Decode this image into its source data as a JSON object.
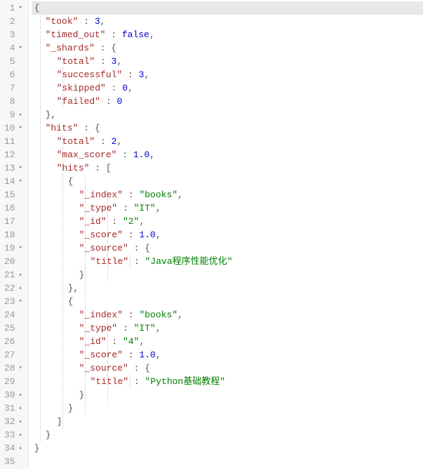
{
  "lines": [
    {
      "n": 1,
      "fold": "▾",
      "active": true,
      "guides": [],
      "indent": 0,
      "tokens": [
        {
          "t": "punc",
          "v": "{"
        }
      ]
    },
    {
      "n": 2,
      "fold": "",
      "active": false,
      "guides": [
        1
      ],
      "indent": 1,
      "tokens": [
        {
          "t": "key",
          "v": "\"took\""
        },
        {
          "t": "punc",
          "v": " : "
        },
        {
          "t": "num",
          "v": "3"
        },
        {
          "t": "punc",
          "v": ","
        }
      ]
    },
    {
      "n": 3,
      "fold": "",
      "active": false,
      "guides": [
        1
      ],
      "indent": 1,
      "tokens": [
        {
          "t": "key",
          "v": "\"timed_out\""
        },
        {
          "t": "punc",
          "v": " : "
        },
        {
          "t": "bool",
          "v": "false"
        },
        {
          "t": "punc",
          "v": ","
        }
      ]
    },
    {
      "n": 4,
      "fold": "▾",
      "active": false,
      "guides": [
        1
      ],
      "indent": 1,
      "tokens": [
        {
          "t": "key",
          "v": "\"_shards\""
        },
        {
          "t": "punc",
          "v": " : {"
        }
      ]
    },
    {
      "n": 5,
      "fold": "",
      "active": false,
      "guides": [
        1,
        2
      ],
      "indent": 2,
      "tokens": [
        {
          "t": "key",
          "v": "\"total\""
        },
        {
          "t": "punc",
          "v": " : "
        },
        {
          "t": "num",
          "v": "3"
        },
        {
          "t": "punc",
          "v": ","
        }
      ]
    },
    {
      "n": 6,
      "fold": "",
      "active": false,
      "guides": [
        1,
        2
      ],
      "indent": 2,
      "tokens": [
        {
          "t": "key",
          "v": "\"successful\""
        },
        {
          "t": "punc",
          "v": " : "
        },
        {
          "t": "num",
          "v": "3"
        },
        {
          "t": "punc",
          "v": ","
        }
      ]
    },
    {
      "n": 7,
      "fold": "",
      "active": false,
      "guides": [
        1,
        2
      ],
      "indent": 2,
      "tokens": [
        {
          "t": "key",
          "v": "\"skipped\""
        },
        {
          "t": "punc",
          "v": " : "
        },
        {
          "t": "num",
          "v": "0"
        },
        {
          "t": "punc",
          "v": ","
        }
      ]
    },
    {
      "n": 8,
      "fold": "",
      "active": false,
      "guides": [
        1,
        2
      ],
      "indent": 2,
      "tokens": [
        {
          "t": "key",
          "v": "\"failed\""
        },
        {
          "t": "punc",
          "v": " : "
        },
        {
          "t": "num",
          "v": "0"
        }
      ]
    },
    {
      "n": 9,
      "fold": "▴",
      "active": false,
      "guides": [
        1
      ],
      "indent": 1,
      "tokens": [
        {
          "t": "punc",
          "v": "},"
        }
      ]
    },
    {
      "n": 10,
      "fold": "▾",
      "active": false,
      "guides": [
        1
      ],
      "indent": 1,
      "tokens": [
        {
          "t": "key",
          "v": "\"hits\""
        },
        {
          "t": "punc",
          "v": " : {"
        }
      ]
    },
    {
      "n": 11,
      "fold": "",
      "active": false,
      "guides": [
        1,
        2
      ],
      "indent": 2,
      "tokens": [
        {
          "t": "key",
          "v": "\"total\""
        },
        {
          "t": "punc",
          "v": " : "
        },
        {
          "t": "num",
          "v": "2"
        },
        {
          "t": "punc",
          "v": ","
        }
      ]
    },
    {
      "n": 12,
      "fold": "",
      "active": false,
      "guides": [
        1,
        2
      ],
      "indent": 2,
      "tokens": [
        {
          "t": "key",
          "v": "\"max_score\""
        },
        {
          "t": "punc",
          "v": " : "
        },
        {
          "t": "num",
          "v": "1.0"
        },
        {
          "t": "punc",
          "v": ","
        }
      ]
    },
    {
      "n": 13,
      "fold": "▾",
      "active": false,
      "guides": [
        1,
        2
      ],
      "indent": 2,
      "tokens": [
        {
          "t": "key",
          "v": "\"hits\""
        },
        {
          "t": "punc",
          "v": " : ["
        }
      ]
    },
    {
      "n": 14,
      "fold": "▾",
      "active": false,
      "guides": [
        1,
        2,
        3
      ],
      "indent": 3,
      "tokens": [
        {
          "t": "punc",
          "v": "{"
        }
      ]
    },
    {
      "n": 15,
      "fold": "",
      "active": false,
      "guides": [
        1,
        2,
        3,
        4
      ],
      "indent": 4,
      "tokens": [
        {
          "t": "key",
          "v": "\"_index\""
        },
        {
          "t": "punc",
          "v": " : "
        },
        {
          "t": "str",
          "v": "\"books\""
        },
        {
          "t": "punc",
          "v": ","
        }
      ]
    },
    {
      "n": 16,
      "fold": "",
      "active": false,
      "guides": [
        1,
        2,
        3,
        4
      ],
      "indent": 4,
      "tokens": [
        {
          "t": "key",
          "v": "\"_type\""
        },
        {
          "t": "punc",
          "v": " : "
        },
        {
          "t": "str",
          "v": "\"IT\""
        },
        {
          "t": "punc",
          "v": ","
        }
      ]
    },
    {
      "n": 17,
      "fold": "",
      "active": false,
      "guides": [
        1,
        2,
        3,
        4
      ],
      "indent": 4,
      "tokens": [
        {
          "t": "key",
          "v": "\"_id\""
        },
        {
          "t": "punc",
          "v": " : "
        },
        {
          "t": "str",
          "v": "\"2\""
        },
        {
          "t": "punc",
          "v": ","
        }
      ]
    },
    {
      "n": 18,
      "fold": "",
      "active": false,
      "guides": [
        1,
        2,
        3,
        4
      ],
      "indent": 4,
      "tokens": [
        {
          "t": "key",
          "v": "\"_score\""
        },
        {
          "t": "punc",
          "v": " : "
        },
        {
          "t": "num",
          "v": "1.0"
        },
        {
          "t": "punc",
          "v": ","
        }
      ]
    },
    {
      "n": 19,
      "fold": "▾",
      "active": false,
      "guides": [
        1,
        2,
        3,
        4
      ],
      "indent": 4,
      "tokens": [
        {
          "t": "key",
          "v": "\"_source\""
        },
        {
          "t": "punc",
          "v": " : {"
        }
      ]
    },
    {
      "n": 20,
      "fold": "",
      "active": false,
      "guides": [
        1,
        2,
        3,
        4,
        5
      ],
      "indent": 5,
      "tokens": [
        {
          "t": "key",
          "v": "\"title\""
        },
        {
          "t": "punc",
          "v": " : "
        },
        {
          "t": "str",
          "v": "\"Java程序性能优化\""
        }
      ]
    },
    {
      "n": 21,
      "fold": "▴",
      "active": false,
      "guides": [
        1,
        2,
        3,
        4
      ],
      "indent": 4,
      "tokens": [
        {
          "t": "punc",
          "v": "}"
        }
      ]
    },
    {
      "n": 22,
      "fold": "▴",
      "active": false,
      "guides": [
        1,
        2,
        3
      ],
      "indent": 3,
      "tokens": [
        {
          "t": "punc",
          "v": "},"
        }
      ]
    },
    {
      "n": 23,
      "fold": "▾",
      "active": false,
      "guides": [
        1,
        2,
        3
      ],
      "indent": 3,
      "tokens": [
        {
          "t": "punc",
          "v": "{"
        }
      ]
    },
    {
      "n": 24,
      "fold": "",
      "active": false,
      "guides": [
        1,
        2,
        3,
        4
      ],
      "indent": 4,
      "tokens": [
        {
          "t": "key",
          "v": "\"_index\""
        },
        {
          "t": "punc",
          "v": " : "
        },
        {
          "t": "str",
          "v": "\"books\""
        },
        {
          "t": "punc",
          "v": ","
        }
      ]
    },
    {
      "n": 25,
      "fold": "",
      "active": false,
      "guides": [
        1,
        2,
        3,
        4
      ],
      "indent": 4,
      "tokens": [
        {
          "t": "key",
          "v": "\"_type\""
        },
        {
          "t": "punc",
          "v": " : "
        },
        {
          "t": "str",
          "v": "\"IT\""
        },
        {
          "t": "punc",
          "v": ","
        }
      ]
    },
    {
      "n": 26,
      "fold": "",
      "active": false,
      "guides": [
        1,
        2,
        3,
        4
      ],
      "indent": 4,
      "tokens": [
        {
          "t": "key",
          "v": "\"_id\""
        },
        {
          "t": "punc",
          "v": " : "
        },
        {
          "t": "str",
          "v": "\"4\""
        },
        {
          "t": "punc",
          "v": ","
        }
      ]
    },
    {
      "n": 27,
      "fold": "",
      "active": false,
      "guides": [
        1,
        2,
        3,
        4
      ],
      "indent": 4,
      "tokens": [
        {
          "t": "key",
          "v": "\"_score\""
        },
        {
          "t": "punc",
          "v": " : "
        },
        {
          "t": "num",
          "v": "1.0"
        },
        {
          "t": "punc",
          "v": ","
        }
      ]
    },
    {
      "n": 28,
      "fold": "▾",
      "active": false,
      "guides": [
        1,
        2,
        3,
        4
      ],
      "indent": 4,
      "tokens": [
        {
          "t": "key",
          "v": "\"_source\""
        },
        {
          "t": "punc",
          "v": " : {"
        }
      ]
    },
    {
      "n": 29,
      "fold": "",
      "active": false,
      "guides": [
        1,
        2,
        3,
        4,
        5
      ],
      "indent": 5,
      "tokens": [
        {
          "t": "key",
          "v": "\"title\""
        },
        {
          "t": "punc",
          "v": " : "
        },
        {
          "t": "str",
          "v": "\"Python基础教程\""
        }
      ]
    },
    {
      "n": 30,
      "fold": "▴",
      "active": false,
      "guides": [
        1,
        2,
        3,
        4
      ],
      "indent": 4,
      "tokens": [
        {
          "t": "punc",
          "v": "}"
        }
      ]
    },
    {
      "n": 31,
      "fold": "▴",
      "active": false,
      "guides": [
        1,
        2,
        3
      ],
      "indent": 3,
      "tokens": [
        {
          "t": "punc",
          "v": "}"
        }
      ]
    },
    {
      "n": 32,
      "fold": "▴",
      "active": false,
      "guides": [
        1,
        2
      ],
      "indent": 2,
      "tokens": [
        {
          "t": "punc",
          "v": "]"
        }
      ]
    },
    {
      "n": 33,
      "fold": "▴",
      "active": false,
      "guides": [
        1
      ],
      "indent": 1,
      "tokens": [
        {
          "t": "punc",
          "v": "}"
        }
      ]
    },
    {
      "n": 34,
      "fold": "▴",
      "active": false,
      "guides": [],
      "indent": 0,
      "tokens": [
        {
          "t": "punc",
          "v": "}"
        }
      ]
    },
    {
      "n": 35,
      "fold": "",
      "active": false,
      "guides": [],
      "indent": 0,
      "tokens": []
    }
  ]
}
